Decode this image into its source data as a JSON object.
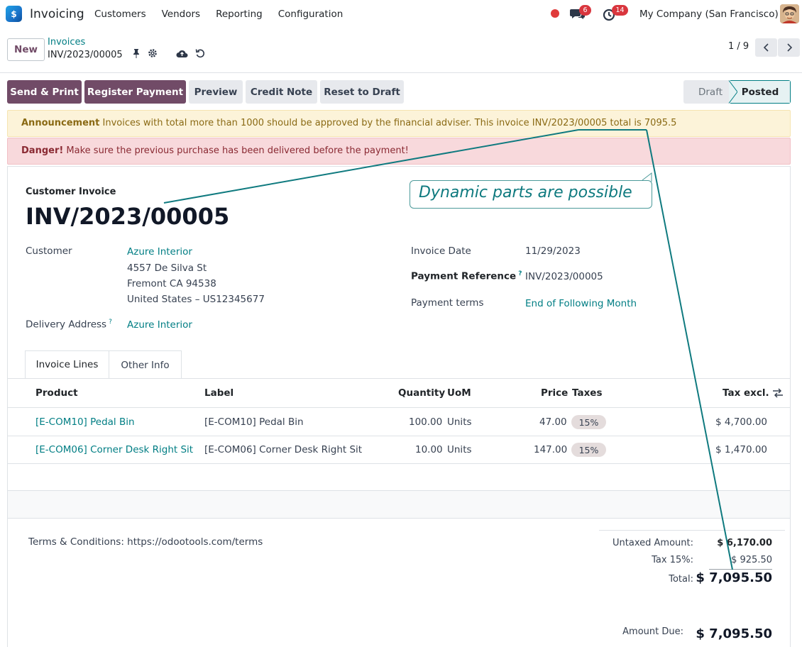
{
  "navbar": {
    "app_name": "Invoicing",
    "menu": [
      "Customers",
      "Vendors",
      "Reporting",
      "Configuration"
    ],
    "messages_count": "6",
    "activities_count": "14",
    "company": "My Company (San Francisco)"
  },
  "control_panel": {
    "new_label": "New",
    "breadcrumb_parent": "Invoices",
    "breadcrumb_current": "INV/2023/00005",
    "pager": "1 / 9"
  },
  "actions": {
    "send_print": "Send & Print",
    "register_payment": "Register Payment",
    "preview": "Preview",
    "credit_note": "Credit Note",
    "reset_draft": "Reset to Draft"
  },
  "statusbar": {
    "draft": "Draft",
    "posted": "Posted"
  },
  "alerts": {
    "announcement_label": "Announcement",
    "announcement_text": " Invoices with total more than 1000 should be approved by the financial adviser. This invoice INV/2023/00005 total is 7095.5",
    "danger_label": "Danger!",
    "danger_text": " Make sure the previous purchase has been delivered before the payment!"
  },
  "callout": "Dynamic parts are possible",
  "invoice": {
    "type": "Customer Invoice",
    "number": "INV/2023/00005",
    "customer_label": "Customer",
    "customer_name": "Azure Interior",
    "address_1": "4557 De Silva St",
    "address_2": "Fremont CA 94538",
    "address_3": "United States – US12345677",
    "delivery_label": "Delivery Address",
    "delivery_value": "Azure Interior",
    "date_label": "Invoice Date",
    "date_value": "11/29/2023",
    "payref_label": "Payment Reference",
    "payref_value": "INV/2023/00005",
    "terms_label": "Payment terms",
    "terms_value": "End of Following Month"
  },
  "tabs": {
    "lines": "Invoice Lines",
    "other": "Other Info"
  },
  "table": {
    "headers": {
      "product": "Product",
      "label": "Label",
      "quantity": "Quantity",
      "uom": "UoM",
      "price": "Price",
      "taxes": "Taxes",
      "tax_excl": "Tax excl."
    },
    "rows": [
      {
        "product": "[E-COM10] Pedal Bin",
        "label": "[E-COM10] Pedal Bin",
        "quantity": "100.00",
        "uom": "Units",
        "price": "47.00",
        "tax": "15%",
        "subtotal": "$ 4,700.00"
      },
      {
        "product": "[E-COM06] Corner Desk Right Sit",
        "label": "[E-COM06] Corner Desk Right Sit",
        "quantity": "10.00",
        "uom": "Units",
        "price": "147.00",
        "tax": "15%",
        "subtotal": "$ 1,470.00"
      }
    ]
  },
  "totals": {
    "terms_conditions": "Terms & Conditions: https://odootools.com/terms",
    "untaxed_label": "Untaxed Amount:",
    "untaxed_value": "$ 6,170.00",
    "tax_label": "Tax 15%:",
    "tax_value": "$ 925.50",
    "total_label": "Total:",
    "total_value": "$ 7,095.50",
    "due_label": "Amount Due:",
    "due_value": "$ 7,095.50"
  },
  "colors": {
    "brand": "#714B67",
    "link": "#017e84",
    "warning_bg": "#fcf3d9",
    "danger_bg": "#f8d9dc"
  }
}
